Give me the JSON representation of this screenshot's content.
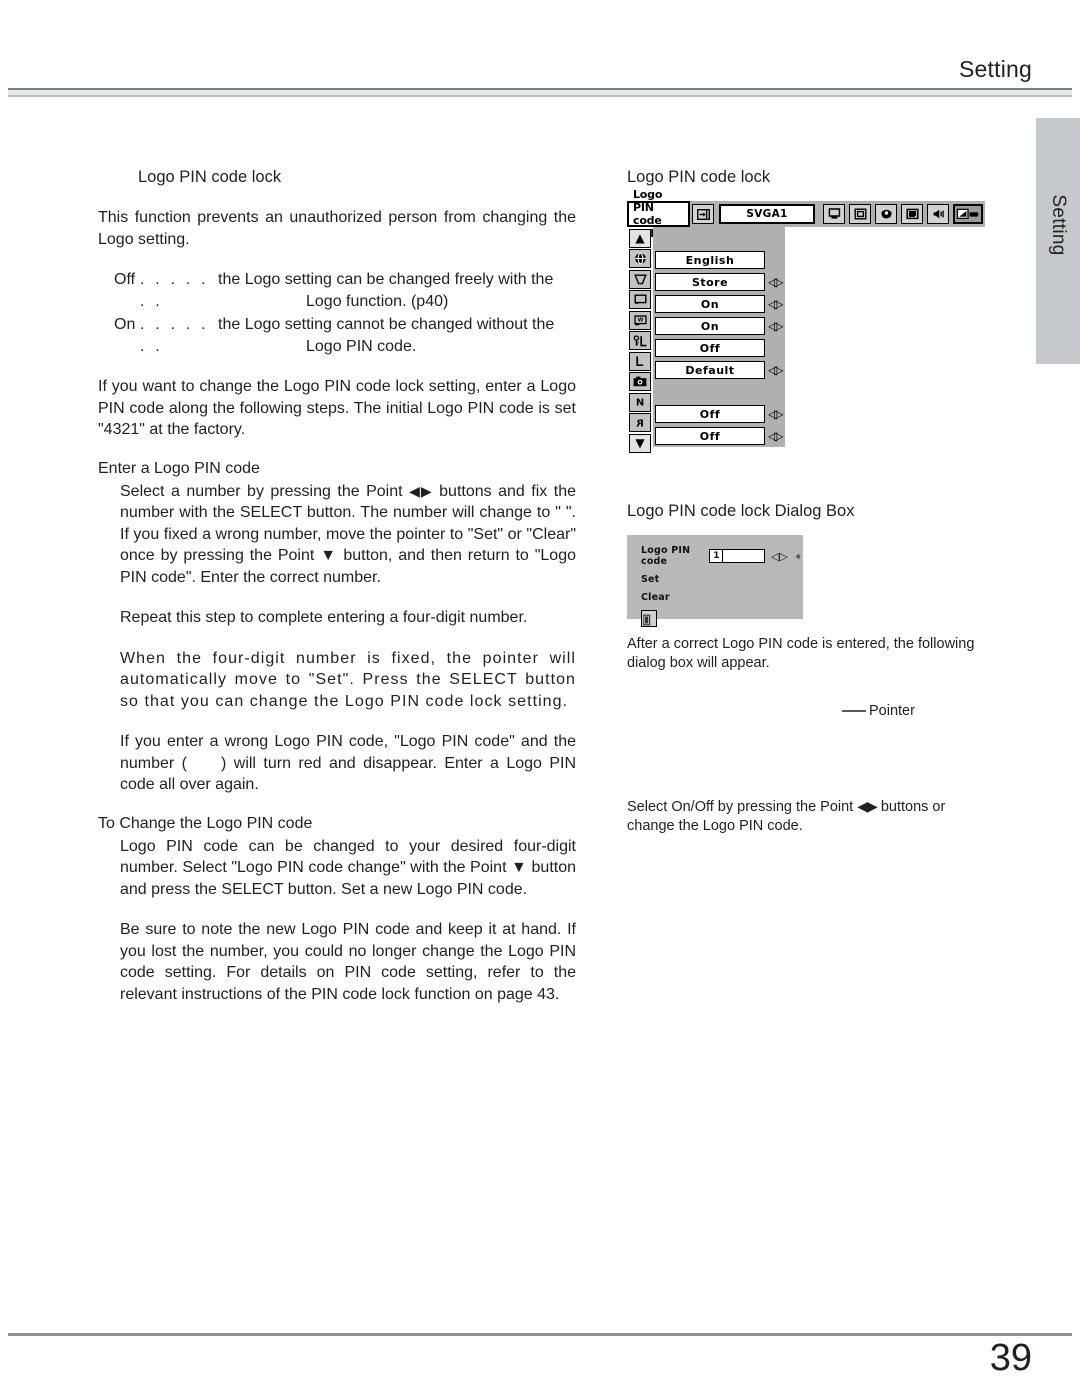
{
  "header": {
    "title": "Setting"
  },
  "side_tab": {
    "label": "Setting"
  },
  "footer": {
    "page_number": "39"
  },
  "left_column": {
    "section_title": "Logo PIN code lock",
    "intro": "This function prevents an unauthorized person from changing the Logo setting.",
    "options": [
      {
        "term": "Off",
        "dots": ". . . . . . .",
        "text": "the Logo setting can be changed freely with the",
        "cont": "Logo function. (p40)"
      },
      {
        "term": "On",
        "dots": ". . . . . . .",
        "text": "the Logo setting cannot be changed without the",
        "cont": "Logo PIN code."
      }
    ],
    "para_change_setting": "If you want to change the Logo PIN code lock setting, enter a Logo PIN code along the following steps. The initial Logo PIN code is set \"4321\" at the factory.",
    "enter_heading": "Enter a Logo PIN code",
    "enter_p1_a": "Select a number by pressing the Point ",
    "enter_p1_arrows": "◀▶",
    "enter_p1_b": " buttons and fix the number with the SELECT button. The number will change to \" \".  If you fixed a wrong number, move the pointer to \"Set\" or \"Clear\" once by pressing the Point ",
    "enter_p1_arrow_down": "▼",
    "enter_p1_c": " button, and then return to \"Logo PIN code\". Enter the correct number.",
    "enter_p2": "Repeat this step to complete entering a four-digit number.",
    "enter_p3": "When the four-digit number is fixed, the pointer will automatically move to \"Set\". Press the SELECT button so that you can change the Logo PIN code lock setting.",
    "enter_p4_a": "If you enter a wrong Logo PIN code, \"Logo PIN code\" and the number (",
    "enter_p4_b": ") will turn red and disappear. Enter a Logo PIN code all over again.",
    "change_heading": "To Change the Logo PIN code",
    "change_p1_a": "Logo PIN code can be changed to your desired four-digit number. Select \"Logo PIN code change\" with the Point ",
    "change_p1_arrow": "▼",
    "change_p1_b": " button and press the SELECT button. Set a new Logo PIN code.",
    "change_p2": "Be sure to note the new Logo PIN code and keep it at hand. If you lost the number, you could no longer change the Logo PIN code setting. For details on PIN code setting, refer to the relevant instructions of the PIN code lock function on page 43."
  },
  "right_column": {
    "menu_caption": "Logo PIN code lock",
    "dialog_caption": "Logo PIN code lock Dialog Box",
    "after_text": "After a correct Logo PIN code is entered, the following dialog box will appear.",
    "pointer_label": "Pointer",
    "bottom_note_a": "Select On/Off by pressing the Point ",
    "bottom_note_arrows": "◀▶",
    "bottom_note_b": " buttons or change the Logo PIN code."
  },
  "osd_menu": {
    "title_label": "Logo PIN code lock",
    "input_icon": "input-source-icon",
    "source_value": "SVGA1",
    "category_icons": [
      "computer-icon",
      "screen-icon",
      "color-adjust-icon",
      "image-icon",
      "sound-icon",
      "setting-icon"
    ],
    "selected_category": "setting-icon",
    "scroll_up": "▲",
    "scroll_down": "▼",
    "rows": [
      {
        "icon": "language-globe-icon",
        "icon_glyph": "⊕",
        "value": "English",
        "has_lr": false
      },
      {
        "icon": "keystone-icon",
        "icon_glyph": "▽",
        "value": "Store",
        "has_lr": true
      },
      {
        "icon": "blue-back-icon",
        "icon_glyph": "□",
        "value": "On",
        "has_lr": true
      },
      {
        "icon": "display-icon",
        "icon_glyph": "▤",
        "value": "On",
        "has_lr": true
      },
      {
        "icon": "logo-pin-lock-icon",
        "icon_glyph": "L",
        "value": "Off",
        "has_lr": false
      },
      {
        "icon": "logo-icon",
        "icon_glyph": "L",
        "value": "Default",
        "has_lr": true
      },
      {
        "icon": "capture-icon",
        "icon_glyph": "▣",
        "value": "",
        "has_lr": false
      },
      {
        "icon": "ceiling-icon",
        "icon_glyph": "И",
        "value": "Off",
        "has_lr": true
      },
      {
        "icon": "rear-icon",
        "icon_glyph": "Я",
        "value": "Off",
        "has_lr": true
      }
    ]
  },
  "osd_dialog": {
    "field_label": "Logo PIN code",
    "field_value": "1",
    "set_label": "Set",
    "clear_label": "Clear",
    "quit_icon": "quit-door-icon"
  }
}
